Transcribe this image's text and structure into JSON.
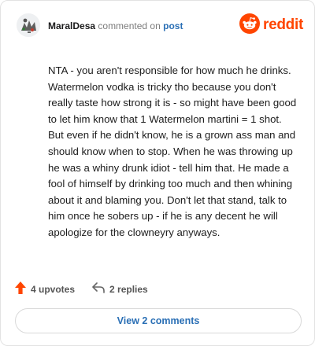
{
  "header": {
    "username": "MaralDesa",
    "action_text": "commented on",
    "post_link": "post",
    "brand_name": "reddit"
  },
  "comment": {
    "text": "NTA - you aren't responsible for how much he drinks. Watermelon vodka is tricky tho because you don't really taste how strong it is - so might have been good to let him know that 1 Watermelon martini = 1 shot. But even if he didn't know, he is a grown ass man and should know when to stop. When he was throwing up he was a whiny drunk idiot - tell him that. He made a fool of himself by drinking too much and then whining about it and blaming you. Don't let that stand, talk to him once he sobers up - if he is any decent he will apologize for the clowneyry anyways."
  },
  "actions": {
    "upvotes_label": "4 upvotes",
    "replies_label": "2 replies"
  },
  "footer": {
    "view_comments_label": "View 2 comments"
  },
  "colors": {
    "brand": "#ff4500",
    "link": "#2a6fb5",
    "upvote": "#ff4500"
  },
  "icons": {
    "avatar": "avatar-icon",
    "brand_logo": "reddit-logo-icon",
    "upvote": "upvote-arrow-icon",
    "reply": "reply-arrow-icon"
  }
}
